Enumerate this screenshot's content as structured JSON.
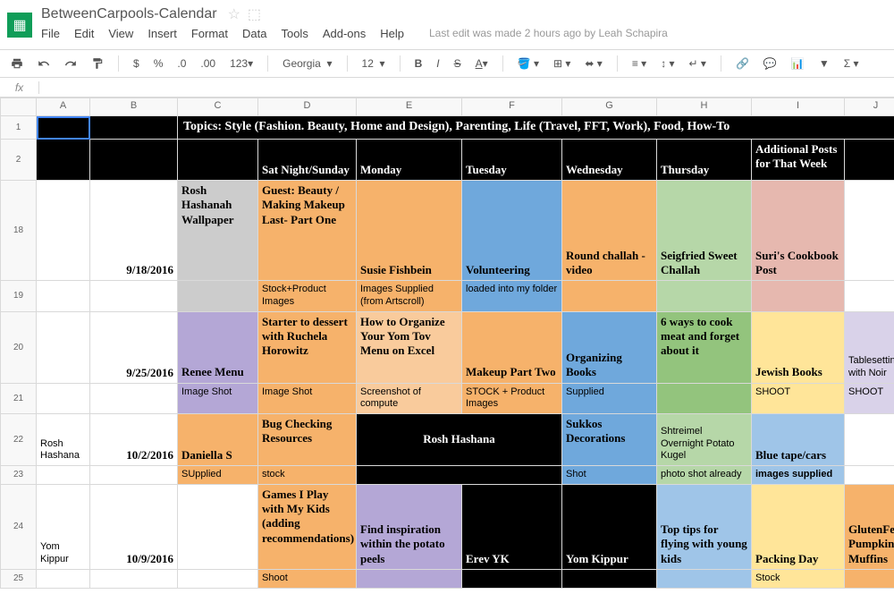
{
  "header": {
    "title": "BetweenCarpools-Calendar"
  },
  "menus": [
    "File",
    "Edit",
    "View",
    "Insert",
    "Format",
    "Data",
    "Tools",
    "Add-ons",
    "Help"
  ],
  "editinfo": "Last edit was made 2 hours ago by Leah Schapira",
  "toolbar": {
    "font": "Georgia",
    "size": "12",
    "currency": "$",
    "pct": "%",
    "dec1": ".0",
    "dec2": ".00",
    "num": "123"
  },
  "sheet": {
    "cols": [
      "A",
      "B",
      "C",
      "D",
      "E",
      "F",
      "G",
      "H",
      "I",
      "J"
    ],
    "rows": [
      "1",
      "2",
      "18",
      "19",
      "20",
      "21",
      "22",
      "23",
      "24",
      "25"
    ],
    "title": "Topics: Style (Fashion. Beauty, Home and Design), Parenting, Life (Travel, FFT, Work), Food, How-To",
    "headers": {
      "D": "Sat Night/Sunday",
      "E": "Monday",
      "F": "Tuesday",
      "G": "Wednesday",
      "H": "Thursday",
      "I": "Additional Posts for That Week"
    },
    "r18": {
      "B": "9/18/2016",
      "C": "Rosh Hashanah Wallpaper",
      "D": "Guest: Beauty / Making Makeup Last- Part One",
      "E": "Susie Fishbein",
      "F": "Volunteering",
      "G": "Round challah - video",
      "H": "Seigfried Sweet Challah",
      "I": "Suri's Cookbook Post"
    },
    "r19": {
      "D": "Stock+Product Images",
      "E": "Images Supplied (from Artscroll)",
      "F": "loaded into my folder"
    },
    "r20": {
      "B": "9/25/2016",
      "C": "Renee Menu",
      "D": "Starter to dessert with Ruchela Horowitz",
      "E": "How to Organize Your Yom Tov Menu on Excel",
      "F": "Makeup Part Two",
      "G": "Organizing Books",
      "H": "6 ways to cook meat and forget about it",
      "I": "Jewish Books",
      "J": "Tablesetting with Noir"
    },
    "r21": {
      "C": "Image Shot",
      "D": "Image Shot",
      "E": "Screenshot of compute",
      "F": "STOCK + Product Images",
      "G": "Supplied",
      "I": "SHOOT",
      "J": "SHOOT"
    },
    "r22": {
      "A": "Rosh Hashana",
      "B": "10/2/2016",
      "C": "Daniella S",
      "D": "Bug Checking Resources",
      "EF": "Rosh Hashana",
      "G": "Sukkos Decorations",
      "H": "Shtreimel Overnight Potato Kugel",
      "I": "Blue tape/cars"
    },
    "r23": {
      "C": "SUpplied",
      "D": "stock",
      "G": "Shot",
      "H": "photo shot already",
      "I": "images supplied"
    },
    "r24": {
      "A": "Yom Kippur",
      "B": "10/9/2016",
      "D": "Games I Play with My Kids (adding recommendations)",
      "E": "Find inspiration within the potato peels",
      "F": "Erev YK",
      "G": "Yom Kippur",
      "H": "Top tips for flying with young kids",
      "I": "Packing Day",
      "J": "GlutenFee Pumpkin Muffins"
    },
    "r25": {
      "D": "Shoot",
      "I": "Stock"
    }
  }
}
